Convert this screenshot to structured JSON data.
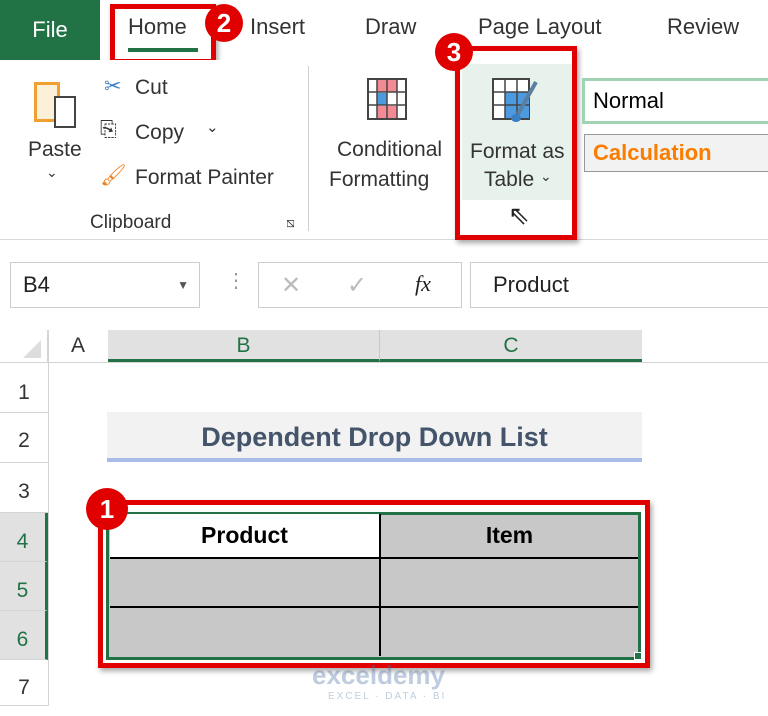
{
  "tabs": [
    "File",
    "Home",
    "Insert",
    "Draw",
    "Page Layout",
    "Review"
  ],
  "clipboard": {
    "paste": "Paste",
    "cut": "Cut",
    "copy": "Copy",
    "format_painter": "Format Painter",
    "group": "Clipboard"
  },
  "styles": {
    "conditional_1": "Conditional",
    "conditional_2": "Formatting",
    "format_table_1": "Format as",
    "format_table_2": "Table",
    "normal": "Normal",
    "calculation": "Calculation"
  },
  "formula_bar": {
    "name_box": "B4",
    "fx": "fx",
    "content": "Product"
  },
  "columns": [
    "A",
    "B",
    "C"
  ],
  "rows": [
    "1",
    "2",
    "3",
    "4",
    "5",
    "6",
    "7"
  ],
  "sheet": {
    "title": "Dependent Drop Down List",
    "headers": [
      "Product",
      "Item"
    ]
  },
  "badges": [
    "1",
    "2",
    "3"
  ],
  "watermark": {
    "brand": "exceldemy",
    "tagline": "EXCEL · DATA · BI"
  },
  "colors": {
    "excel_green": "#217346",
    "highlight_red": "#e00000",
    "title_text": "#44546a",
    "calculation": "#fa7d00"
  }
}
